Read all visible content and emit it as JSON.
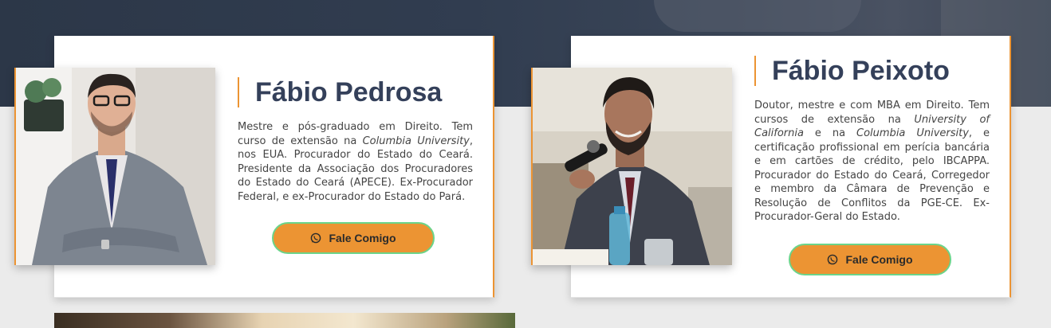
{
  "profiles": [
    {
      "name": "Fábio Pedrosa",
      "bio_html": "Mestre e pós-graduado em Direito. Tem curso de extensão na <em>Columbia University</em>, nos EUA. Procurador do Estado do Ceará. Presidente da Associação dos Procuradores do Estado do Ceará (APECE). Ex-Procurador Federal, e ex-Procurador do Estado do Pará.",
      "button_label": "Fale Comigo",
      "button_icon": "whatsapp-icon"
    },
    {
      "name": "Fábio Peixoto",
      "bio_html": "Doutor, mestre e com MBA em Direito. Tem cursos de extensão na <em>University of California</em> e na <em>Columbia University</em>, e certificação profissional em perícia bancária e em cartões de crédito, pelo IBCAPPA. Procurador do Estado do Ceará, Corregedor e membro da Câmara de Prevenção e Resolução de Conflitos da PGE-CE. Ex-Procurador-Geral do Estado.",
      "button_label": "Fale Comigo",
      "button_icon": "whatsapp-icon"
    }
  ],
  "colors": {
    "accent": "#ec9433",
    "name_text": "#34405a",
    "button_border": "#6bd48a",
    "hero_band": "#2c3748"
  }
}
